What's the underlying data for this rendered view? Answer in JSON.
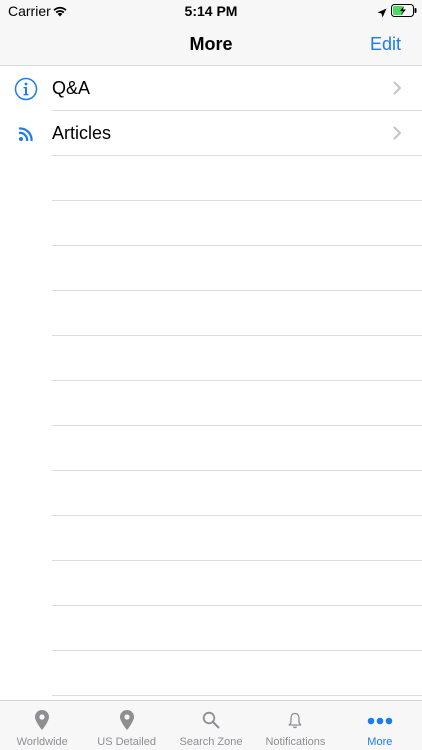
{
  "status_bar": {
    "carrier": "Carrier",
    "time": "5:14 PM",
    "battery_color": "#4cd964"
  },
  "nav": {
    "title": "More",
    "edit_label": "Edit"
  },
  "accent_color": "#1b7cf2",
  "list": {
    "items": [
      {
        "label": "Q&A",
        "icon": "info-circle-icon"
      },
      {
        "label": "Articles",
        "icon": "rss-feed-icon"
      }
    ]
  },
  "tab_bar": {
    "tabs": [
      {
        "label": "Worldwide",
        "icon": "map-pin-icon",
        "active": false
      },
      {
        "label": "US Detailed",
        "icon": "map-pin-icon",
        "active": false
      },
      {
        "label": "Search Zone",
        "icon": "search-icon",
        "active": false
      },
      {
        "label": "Notifications",
        "icon": "bell-icon",
        "active": false
      },
      {
        "label": "More",
        "icon": "more-dots-icon",
        "active": true
      }
    ]
  }
}
